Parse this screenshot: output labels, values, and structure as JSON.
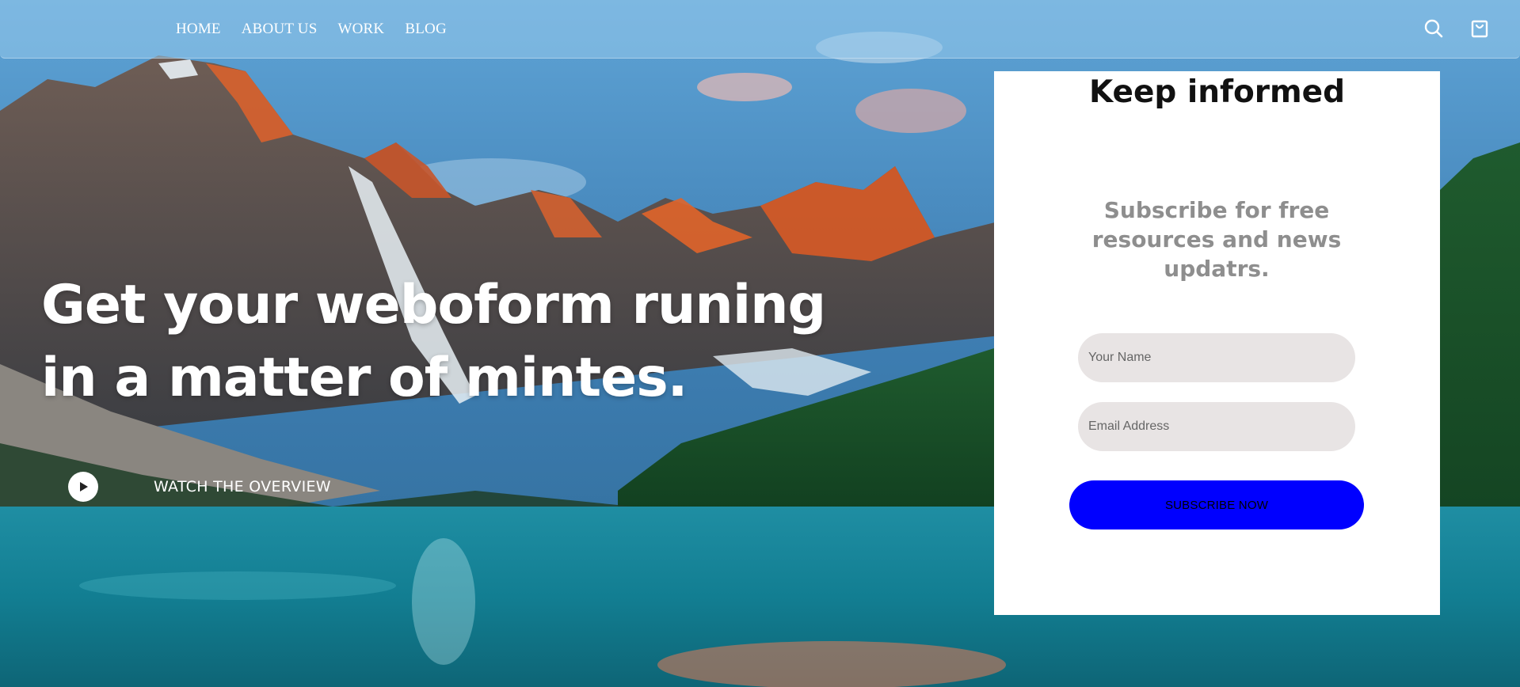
{
  "nav": {
    "items": [
      {
        "label": "HOME"
      },
      {
        "label": "ABOUT US"
      },
      {
        "label": "WORK"
      },
      {
        "label": "BLOG"
      }
    ],
    "icons": [
      "search-icon",
      "shopping-bag-icon"
    ]
  },
  "hero": {
    "title_line1": "Get your weboform runing",
    "title_line2": "in a matter of mintes.",
    "watch_label": "WATCH THE OVERVIEW",
    "play_icon": "play-icon"
  },
  "card": {
    "title": "Keep informed",
    "subtitle": "Subscribe for free resources and news updatrs.",
    "name_placeholder": "Your Name",
    "email_placeholder": "Email Address",
    "button_label": "SUBSCRIBE NOW"
  },
  "colors": {
    "card_bg": "#ffffff",
    "field_bg": "#e8e4e4",
    "button_bg": "#0000ff",
    "subtitle": "#8e8e8e",
    "nav_bar": "#96c8eb"
  }
}
